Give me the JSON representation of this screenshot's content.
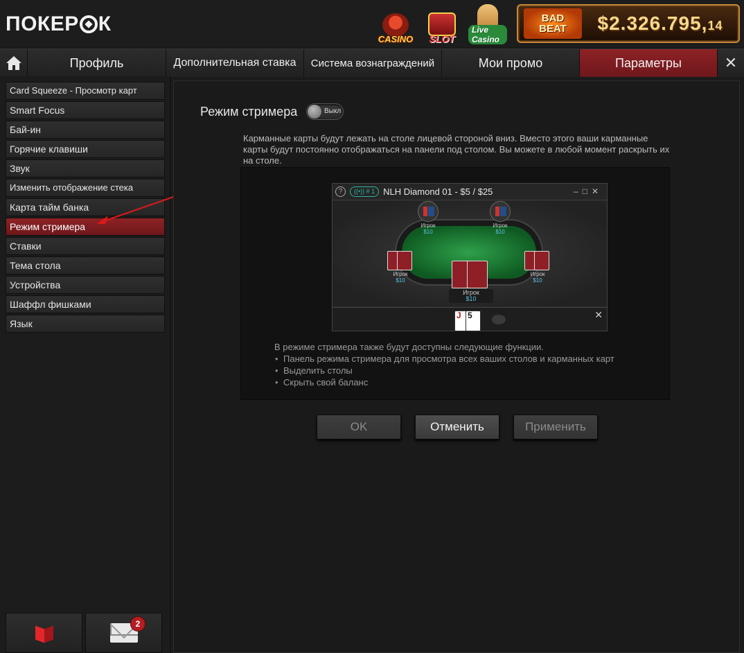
{
  "header": {
    "logo_text_pre": "ПОКЕР",
    "logo_text_post": "К",
    "games": [
      {
        "label": "CASINO",
        "icon": "casino-roulette-icon"
      },
      {
        "label": "SLOT",
        "icon": "slot-machine-icon"
      },
      {
        "label": "Live Casino",
        "icon": "live-casino-icon"
      }
    ],
    "badbeat": {
      "line1": "BAD",
      "line2": "BEAT",
      "amount_main": "$2.326.795,",
      "amount_cents": "14"
    }
  },
  "tabs": {
    "home_icon": "home-icon",
    "items": [
      "Профиль",
      "Дополнительная ставка",
      "Система вознаграждений",
      "Мои промо",
      "Параметры"
    ],
    "active": "Параметры",
    "close": "✕"
  },
  "sidebar": {
    "items": [
      "Card Squeeze - Просмотр карт",
      "Smart Focus",
      "Бай-ин",
      "Горячие клавиши",
      "Звук",
      "Изменить отображение стека",
      "Карта тайм банка",
      "Режим стримера",
      "Ставки",
      "Тема стола",
      "Устройства",
      "Шаффл фишками",
      "Язык"
    ],
    "active": "Режим стримера",
    "mail_count": "2"
  },
  "main": {
    "title": "Режим стримера",
    "toggle_state": "Выкл",
    "description": "Карманные карты будут лежать на столе лицевой стороной вниз. Вместо этого ваши карманные карты будут постоянно отображаться на панели под столом. Вы можете в любой момент раскрыть их на столе.",
    "preview": {
      "help": "?",
      "live_badge": "((•)) # 1",
      "table_title": "NLH Diamond 01 - $5 / $25",
      "window_controls": "‒□✕",
      "seats": [
        {
          "name": "Игрок",
          "stack": "$10"
        },
        {
          "name": "Игрок",
          "stack": "$10"
        },
        {
          "name": "Игрок",
          "stack": "$10"
        },
        {
          "name": "Игрок",
          "stack": "$10"
        },
        {
          "name": "Игрок",
          "stack": "$10"
        }
      ],
      "dock_cards": [
        "J",
        "5"
      ],
      "dock_close": "✕"
    },
    "features_intro": "В режиме стримера также будут доступны следующие функции.",
    "features": [
      "Панель режима стримера для просмотра всех ваших столов и карманных карт",
      "Выделить столы",
      "Скрыть свой баланс"
    ],
    "buttons": {
      "ok": "OK",
      "cancel": "Отменить",
      "apply": "Применить"
    }
  },
  "colors": {
    "accent_red": "#8e2226",
    "background": "#1b1b1b",
    "money_blue": "#5ec1e8"
  }
}
